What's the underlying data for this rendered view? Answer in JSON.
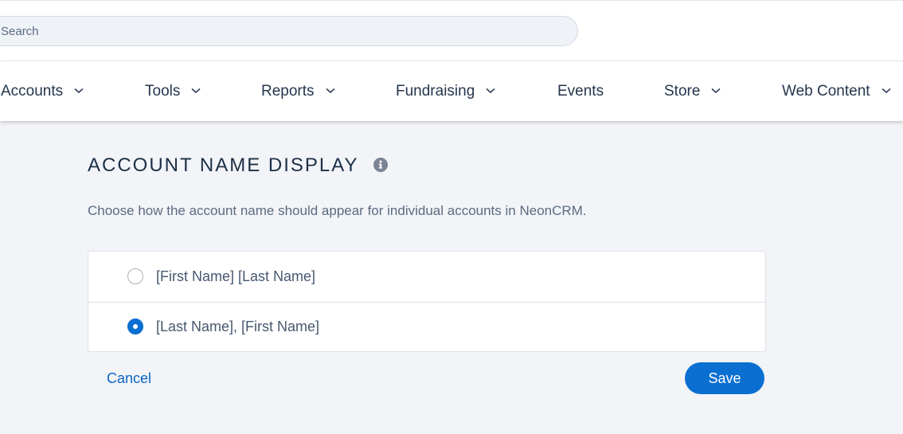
{
  "search": {
    "placeholder": "Search"
  },
  "nav": {
    "items": [
      {
        "label": "Accounts",
        "has_dropdown": true
      },
      {
        "label": "Tools",
        "has_dropdown": true
      },
      {
        "label": "Reports",
        "has_dropdown": true
      },
      {
        "label": "Fundraising",
        "has_dropdown": true
      },
      {
        "label": "Events",
        "has_dropdown": false
      },
      {
        "label": "Store",
        "has_dropdown": true
      },
      {
        "label": "Web Content",
        "has_dropdown": true
      }
    ]
  },
  "main": {
    "title": "ACCOUNT NAME DISPLAY",
    "info_icon": "info-circle-icon",
    "description": "Choose how the account name should appear for individual accounts in NeonCRM.",
    "options": [
      {
        "label": "[First Name] [Last Name]",
        "selected": false
      },
      {
        "label": "[Last Name], [First Name]",
        "selected": true
      }
    ],
    "cancel_label": "Cancel",
    "save_label": "Save"
  },
  "colors": {
    "accent": "#0a6fd1",
    "background": "#f3f4f8",
    "title": "#1c2f45",
    "body_text": "#5c6b80"
  }
}
